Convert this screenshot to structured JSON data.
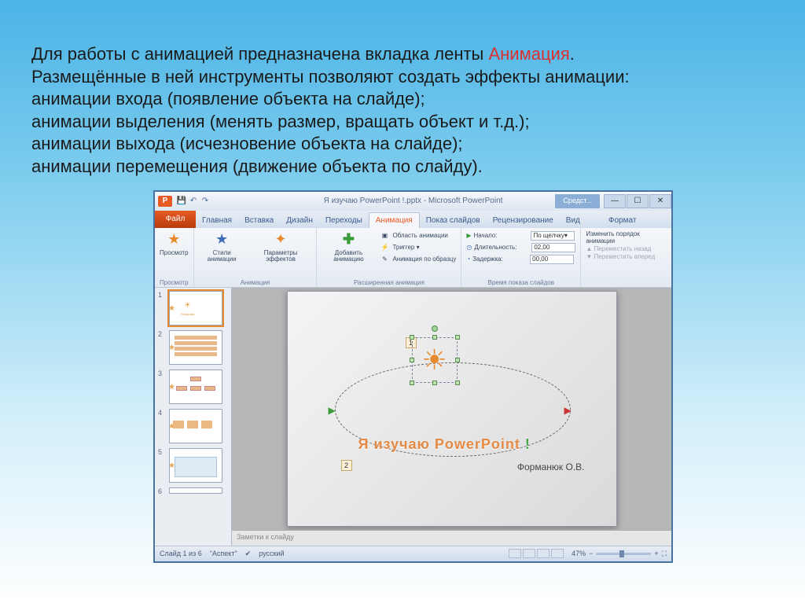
{
  "slide_text": {
    "line1a": "Для работы с анимацией предназначена вкладка ленты ",
    "line1b": "Анимация",
    "line1c": ".",
    "line2": "Размещённые в ней инструменты позволяют создать  эффекты анимации:",
    "line3": "анимации входа (появление объекта на слайде);",
    "line4": "анимации выделения (менять размер, вращать объект и т.д.);",
    "line5": "анимации выхода (исчезновение объекта на слайде);",
    "line6": "анимации перемещения (движение объекта по слайду)."
  },
  "titlebar": {
    "app_title": "Я изучаю PowerPoint !.pptx  -  Microsoft PowerPoint",
    "tools_context": "Средст..."
  },
  "tabs": {
    "file": "Файл",
    "items": [
      "Главная",
      "Вставка",
      "Дизайн",
      "Переходы",
      "Анимация",
      "Показ слайдов",
      "Рецензирование",
      "Вид"
    ],
    "format": "Формат",
    "active_index": 4
  },
  "ribbon": {
    "group_preview": "Просмотр",
    "btn_preview": "Просмотр",
    "group_animation": "Анимация",
    "btn_styles": "Стили анимации",
    "btn_params": "Параметры эффектов",
    "group_advanced": "Расширенная анимация",
    "btn_add": "Добавить анимацию",
    "adv_pane": "Область анимации",
    "adv_trigger": "Триггер ▾",
    "adv_painter": "Анимация по образцу",
    "group_timing": "Время показа слайдов",
    "t_start_label": "Начало:",
    "t_start_val": "По щелчку",
    "t_dur_label": "Длительность:",
    "t_dur_val": "02,00",
    "t_delay_label": "Задержка:",
    "t_delay_val": "00,00",
    "order_title": "Изменить порядок анимации",
    "order_back": "Переместить назад",
    "order_fwd": "Переместить вперед"
  },
  "thumbs": {
    "count": 6
  },
  "canvas": {
    "title_text": "Я изучаю PowerPoint",
    "title_excl": " !",
    "author": "Форманюк О.В.",
    "anim1": "1",
    "anim2": "2"
  },
  "notes": "Заметки к слайду",
  "statusbar": {
    "slide_of": "Слайд 1 из 6",
    "theme": "\"Аспект\"",
    "lang": "русский",
    "zoom": "47%"
  }
}
